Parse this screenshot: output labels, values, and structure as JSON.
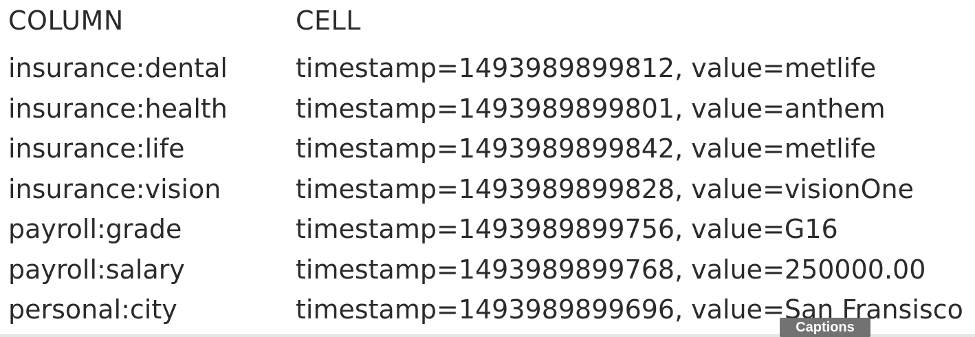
{
  "table": {
    "headers": {
      "column": "COLUMN",
      "cell": "CELL"
    },
    "rows": [
      {
        "column": "insurance:dental",
        "cell": "timestamp=1493989899812, value=metlife"
      },
      {
        "column": "insurance:health",
        "cell": "timestamp=1493989899801, value=anthem"
      },
      {
        "column": "insurance:life",
        "cell": "timestamp=1493989899842, value=metlife"
      },
      {
        "column": "insurance:vision",
        "cell": "timestamp=1493989899828, value=visionOne"
      },
      {
        "column": "payroll:grade",
        "cell": "timestamp=1493989899756, value=G16"
      },
      {
        "column": "payroll:salary",
        "cell": "timestamp=1493989899768, value=250000.00"
      },
      {
        "column": "personal:city",
        "cell": "timestamp=1493989899696, value=San Fransisco"
      }
    ]
  },
  "player": {
    "captions_label": "Captions"
  },
  "colors": {
    "text": "#2b2b2b",
    "background": "#ffffff",
    "captions_bg": "#6b6b6b"
  }
}
